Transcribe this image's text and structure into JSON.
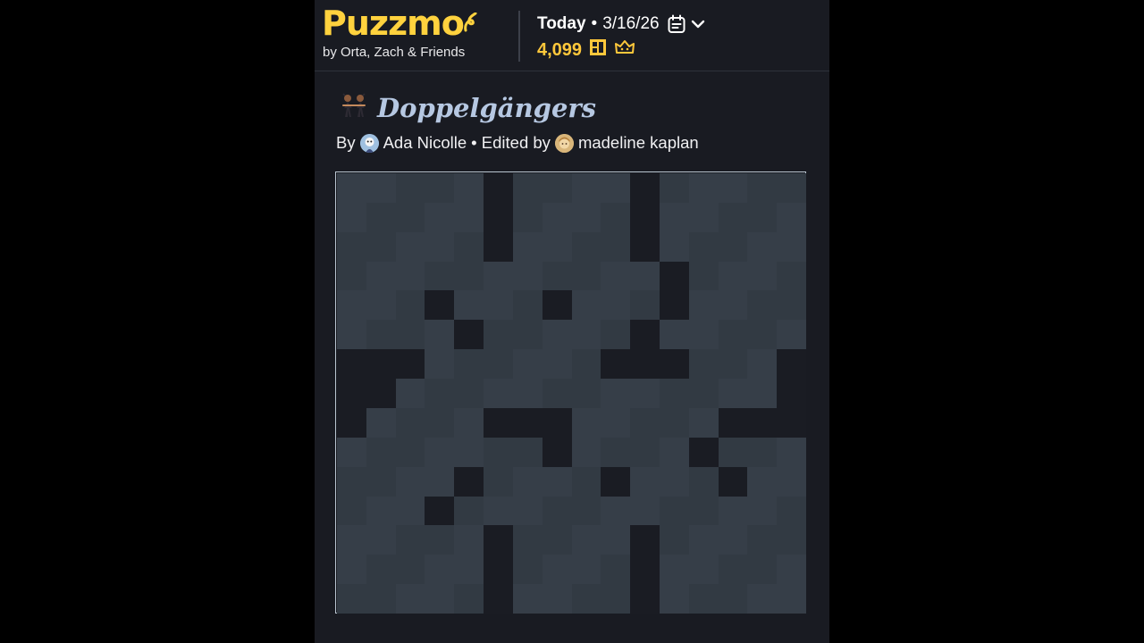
{
  "header": {
    "logo_text": "Puzz",
    "logo_text_tail": "mo",
    "byline": "by Orta, Zach & Friends",
    "today_label": "Today",
    "separator": "•",
    "date": "3/16/26",
    "points": "4,099",
    "icons": [
      "calendar-icon",
      "chevron-down-icon",
      "grid-stamp-icon",
      "crown-icon"
    ],
    "accent_color": "#ffd23e"
  },
  "game": {
    "emoji": "👯",
    "title": "Doppelgängers",
    "by_label": "By",
    "author": "Ada Nicolle",
    "edited_by_label": "• Edited by",
    "editor": "madeline kaplan"
  },
  "grid": {
    "cols": 16,
    "rows": 15,
    "layout": [
      ".....#....#.....",
      ".....#....#.....",
      ".....#....#.....",
      "...........#....",
      "...#...#...#....",
      "....#.....#.....",
      "###......###...#",
      "##.............#",
      "#....###.....###",
      ".......#....#...",
      "....#....#...#..",
      "...#............",
      ".....#....#.....",
      ".....#....#.....",
      ".....#....#....."
    ]
  }
}
